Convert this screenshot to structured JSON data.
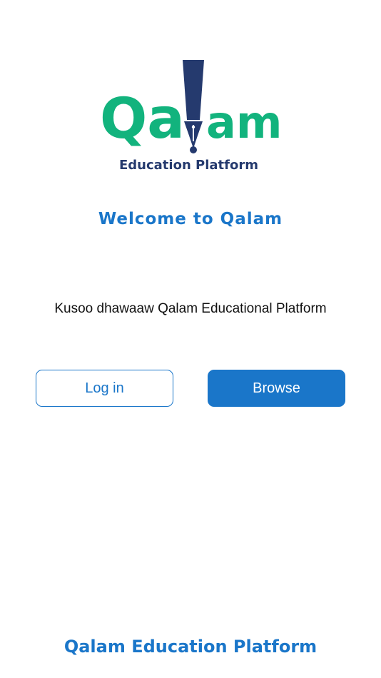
{
  "logo": {
    "brand_left": "Qa",
    "brand_right": "am",
    "subtitle": "Education Platform",
    "icon": "pen-nib-icon",
    "colors": {
      "green": "#12b37d",
      "navy": "#253a6e"
    }
  },
  "welcome": {
    "title": "Welcome to Qalam",
    "tagline": "Kusoo dhawaaw Qalam Educational Platform"
  },
  "actions": {
    "login_label": "Log in",
    "browse_label": "Browse"
  },
  "footer": {
    "text": "Qalam Education Platform"
  },
  "colors": {
    "accent": "#1a76c9",
    "background": "#ffffff"
  }
}
